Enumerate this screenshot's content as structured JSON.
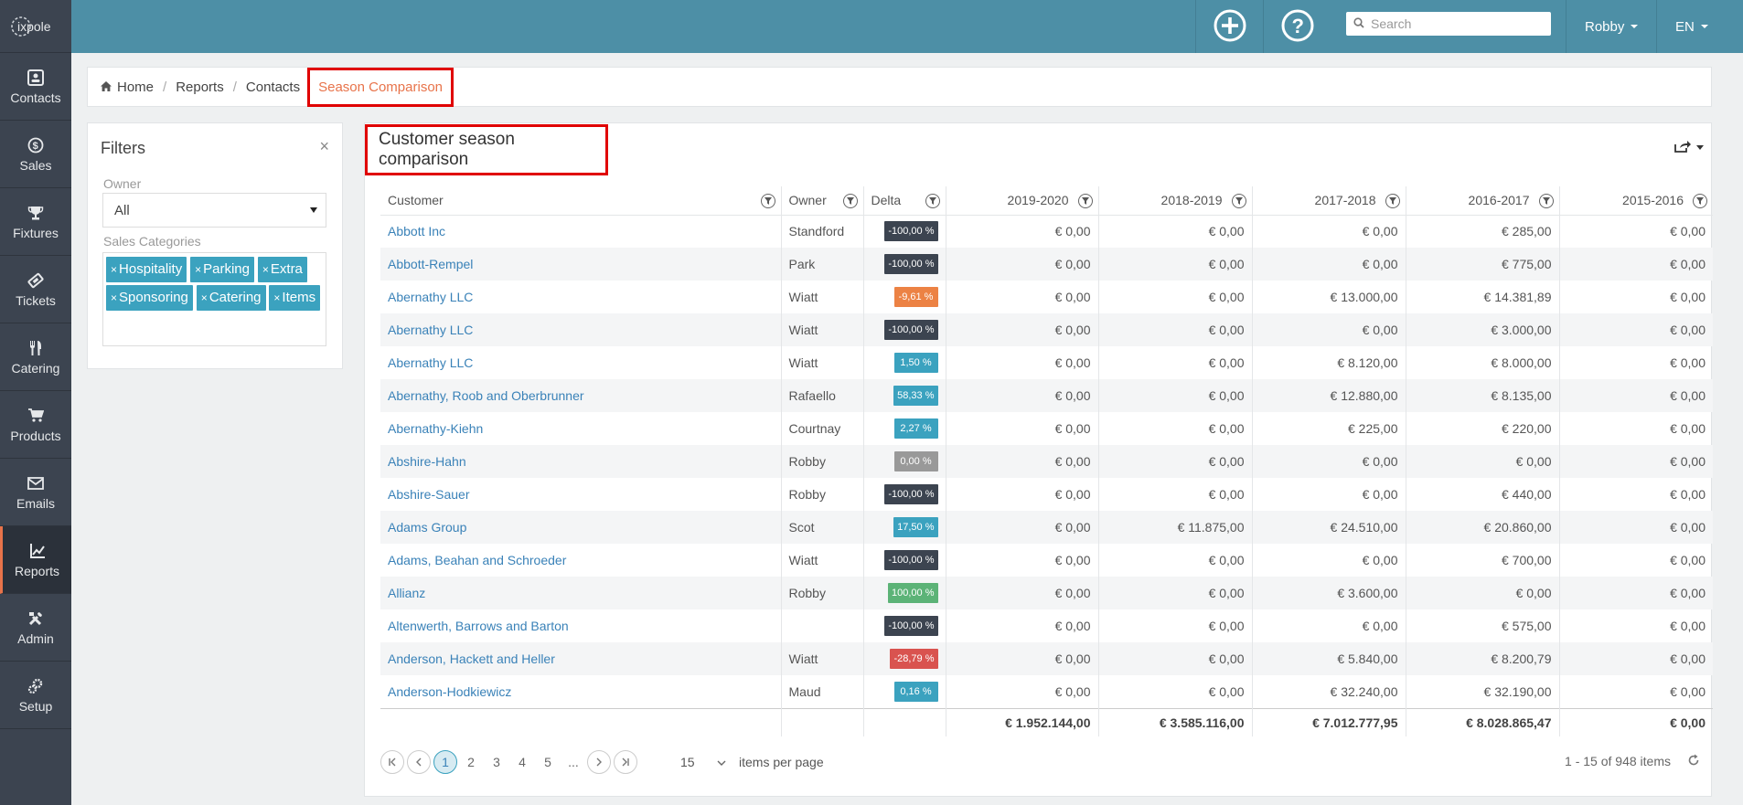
{
  "app": {
    "logo_text": "ixpole"
  },
  "sidebar": {
    "items": [
      {
        "label": "Contacts",
        "icon": "contacts-icon"
      },
      {
        "label": "Sales",
        "icon": "dollar-icon"
      },
      {
        "label": "Fixtures",
        "icon": "trophy-icon"
      },
      {
        "label": "Tickets",
        "icon": "ticket-icon"
      },
      {
        "label": "Catering",
        "icon": "cutlery-icon"
      },
      {
        "label": "Products",
        "icon": "cart-icon"
      },
      {
        "label": "Emails",
        "icon": "envelope-icon"
      },
      {
        "label": "Reports",
        "icon": "chart-icon"
      },
      {
        "label": "Admin",
        "icon": "tools-icon"
      },
      {
        "label": "Setup",
        "icon": "gears-icon"
      }
    ]
  },
  "topbar": {
    "search_placeholder": "Search",
    "user": "Robby",
    "language": "EN"
  },
  "breadcrumb": {
    "home": "Home",
    "reports": "Reports",
    "contacts": "Contacts",
    "current": "Season Comparison"
  },
  "filters": {
    "title": "Filters",
    "close": "×",
    "owner_label": "Owner",
    "owner_value": "All",
    "categories_label": "Sales Categories",
    "categories": [
      "Hospitality",
      "Parking",
      "Extra",
      "Sponsoring",
      "Catering",
      "Items"
    ]
  },
  "main": {
    "title": "Customer season comparison"
  },
  "table": {
    "columns": [
      "Customer",
      "Owner",
      "Delta",
      "2019-2020",
      "2018-2019",
      "2017-2018",
      "2016-2017",
      "2015-2016"
    ],
    "rows": [
      {
        "customer": "Abbott Inc",
        "owner": "Standford",
        "delta": "-100,00 %",
        "delta_color": "#3c4450",
        "v": [
          "€ 0,00",
          "€ 0,00",
          "€ 0,00",
          "€ 285,00",
          "€ 0,00"
        ]
      },
      {
        "customer": "Abbott-Rempel",
        "owner": "Park",
        "delta": "-100,00 %",
        "delta_color": "#3c4450",
        "v": [
          "€ 0,00",
          "€ 0,00",
          "€ 0,00",
          "€ 775,00",
          "€ 0,00"
        ]
      },
      {
        "customer": "Abernathy LLC",
        "owner": "Wiatt",
        "delta": "-9,61 %",
        "delta_color": "#ec8244",
        "v": [
          "€ 0,00",
          "€ 0,00",
          "€ 13.000,00",
          "€ 14.381,89",
          "€ 0,00"
        ]
      },
      {
        "customer": "Abernathy LLC",
        "owner": "Wiatt",
        "delta": "-100,00 %",
        "delta_color": "#3c4450",
        "v": [
          "€ 0,00",
          "€ 0,00",
          "€ 0,00",
          "€ 3.000,00",
          "€ 0,00"
        ]
      },
      {
        "customer": "Abernathy LLC",
        "owner": "Wiatt",
        "delta": "1,50 %",
        "delta_color": "#3ba2bf",
        "v": [
          "€ 0,00",
          "€ 0,00",
          "€ 8.120,00",
          "€ 8.000,00",
          "€ 0,00"
        ]
      },
      {
        "customer": "Abernathy, Roob and Oberbrunner",
        "owner": "Rafaello",
        "delta": "58,33 %",
        "delta_color": "#3ba2bf",
        "v": [
          "€ 0,00",
          "€ 0,00",
          "€ 12.880,00",
          "€ 8.135,00",
          "€ 0,00"
        ]
      },
      {
        "customer": "Abernathy-Kiehn",
        "owner": "Courtnay",
        "delta": "2,27 %",
        "delta_color": "#3ba2bf",
        "v": [
          "€ 0,00",
          "€ 0,00",
          "€ 225,00",
          "€ 220,00",
          "€ 0,00"
        ]
      },
      {
        "customer": "Abshire-Hahn",
        "owner": "Robby",
        "delta": "0,00 %",
        "delta_color": "#999999",
        "v": [
          "€ 0,00",
          "€ 0,00",
          "€ 0,00",
          "€ 0,00",
          "€ 0,00"
        ]
      },
      {
        "customer": "Abshire-Sauer",
        "owner": "Robby",
        "delta": "-100,00 %",
        "delta_color": "#3c4450",
        "v": [
          "€ 0,00",
          "€ 0,00",
          "€ 0,00",
          "€ 440,00",
          "€ 0,00"
        ]
      },
      {
        "customer": "Adams Group",
        "owner": "Scot",
        "delta": "17,50 %",
        "delta_color": "#3ba2bf",
        "v": [
          "€ 0,00",
          "€ 11.875,00",
          "€ 24.510,00",
          "€ 20.860,00",
          "€ 0,00"
        ]
      },
      {
        "customer": "Adams, Beahan and Schroeder",
        "owner": "Wiatt",
        "delta": "-100,00 %",
        "delta_color": "#3c4450",
        "v": [
          "€ 0,00",
          "€ 0,00",
          "€ 0,00",
          "€ 700,00",
          "€ 0,00"
        ]
      },
      {
        "customer": "Allianz",
        "owner": "Robby",
        "delta": "100,00 %",
        "delta_color": "#5cb377",
        "v": [
          "€ 0,00",
          "€ 0,00",
          "€ 3.600,00",
          "€ 0,00",
          "€ 0,00"
        ]
      },
      {
        "customer": "Altenwerth, Barrows and Barton",
        "owner": "",
        "delta": "-100,00 %",
        "delta_color": "#3c4450",
        "v": [
          "€ 0,00",
          "€ 0,00",
          "€ 0,00",
          "€ 575,00",
          "€ 0,00"
        ]
      },
      {
        "customer": "Anderson, Hackett and Heller",
        "owner": "Wiatt",
        "delta": "-28,79 %",
        "delta_color": "#d9534f",
        "v": [
          "€ 0,00",
          "€ 0,00",
          "€ 5.840,00",
          "€ 8.200,79",
          "€ 0,00"
        ]
      },
      {
        "customer": "Anderson-Hodkiewicz",
        "owner": "Maud",
        "delta": "0,16 %",
        "delta_color": "#3ba2bf",
        "v": [
          "€ 0,00",
          "€ 0,00",
          "€ 32.240,00",
          "€ 32.190,00",
          "€ 0,00"
        ]
      }
    ],
    "totals": [
      "€ 1.952.144,00",
      "€ 3.585.116,00",
      "€ 7.012.777,95",
      "€ 8.028.865,47",
      "€ 0,00"
    ]
  },
  "pager": {
    "pages": [
      "1",
      "2",
      "3",
      "4",
      "5",
      "..."
    ],
    "current": "1",
    "page_size": "15",
    "items_per_page_label": "items per page",
    "info": "1 - 15 of 948 items"
  }
}
